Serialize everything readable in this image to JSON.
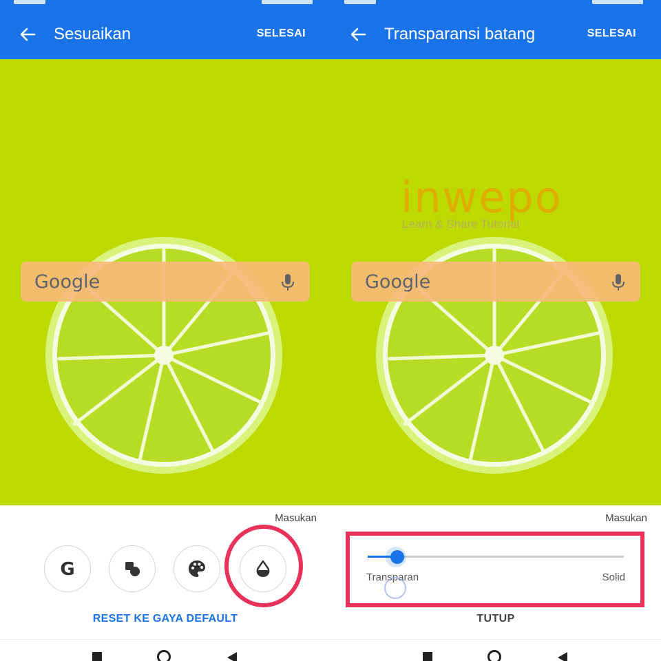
{
  "left_panel": {
    "title": "Sesuaikan",
    "done_label": "SELESAI",
    "search_logo_text": "Google",
    "feedback_label": "Masukan",
    "options": [
      "google-logo-icon",
      "shapes-icon",
      "palette-icon",
      "opacity-drop-icon"
    ],
    "reset_label": "RESET KE GAYA DEFAULT"
  },
  "right_panel": {
    "title": "Transparansi batang",
    "done_label": "SELESAI",
    "search_logo_text": "Google",
    "feedback_label": "Masukan",
    "slider": {
      "min_label": "Transparan",
      "max_label": "Solid",
      "value": 0.1
    },
    "close_label": "TUTUP"
  },
  "watermark": {
    "brand": "inwepo",
    "tagline": "Learn & Share Tutorial"
  },
  "colors": {
    "appbar": "#1a73e8",
    "wallpaper": "#bcd900",
    "highlight": "#e8325a",
    "accent": "#1a73e8"
  }
}
